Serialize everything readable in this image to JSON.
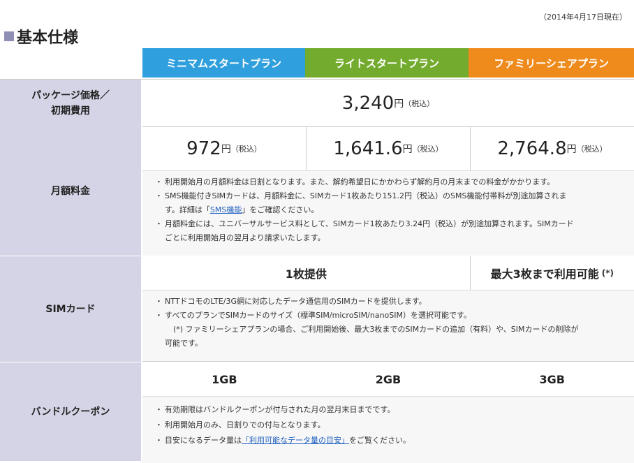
{
  "date_note": "（2014年4月17日現在）",
  "section_title": "基本仕様",
  "plans": [
    "ミニマムスタートプラン",
    "ライトスタートプラン",
    "ファミリーシェアプラン"
  ],
  "colors": {
    "minimum": "#2f9fdd",
    "light": "#72ab2d",
    "family": "#ef8a1d",
    "label_bg": "#d4d4e6"
  },
  "package": {
    "label_l1": "パッケージ価格／",
    "label_l2": "初期費用",
    "price": "3,240",
    "yen": "円",
    "tax": "（税込）"
  },
  "monthly": {
    "label": "月額料金",
    "prices": [
      "972",
      "1,641.6",
      "2,764.8"
    ],
    "yen": "円",
    "tax": "（税込）",
    "note1": "利用開始月の月額料金は日割となります。また、解約希望日にかかわらず解約月の月末までの料金がかかります。",
    "note2_a": "SMS機能付きSIMカードは、月額料金に、SIMカード1枚あたり151.2円（税込）のSMS機能付帯料が別途加算されま",
    "note2_b": "す。詳細は「",
    "note2_link": "SMS機能",
    "note2_c": "」をご確認ください。",
    "note3_a": "月額料金には、ユニバーサルサービス料として、SIMカード1枚あたり3.24円（税込）が別途加算されます。SIMカード",
    "note3_b": "ごとに利用開始月の翌月より請求いたします。"
  },
  "sim": {
    "label": "SIMカード",
    "supply1": "1枚提供",
    "supply2": "最大3枚まで利用可能",
    "mark": "(*)",
    "note1": "NTTドコモのLTE/3G網に対応したデータ通信用のSIMカードを提供します。",
    "note2": "すべてのプランでSIMカードのサイズ（標準SIM/microSIM/nanoSIM）を選択可能です。",
    "note3_a": "(*) ファミリーシェアプランの場合、ご利用開始後、最大3枚までのSIMカードの追加（有料）や、SIMカードの削除が",
    "note3_b": "可能です。"
  },
  "bundle": {
    "label": "バンドルクーポン",
    "amounts": [
      "1GB",
      "2GB",
      "3GB"
    ],
    "note1": "有効期限はバンドルクーポンが付与された月の翌月末日までです。",
    "note2": "利用開始月のみ、日割りでの付与となります。",
    "note3_a": "目安になるデータ量は",
    "note3_link": "「利用可能なデータ量の目安」",
    "note3_b": "をご覧ください。"
  }
}
